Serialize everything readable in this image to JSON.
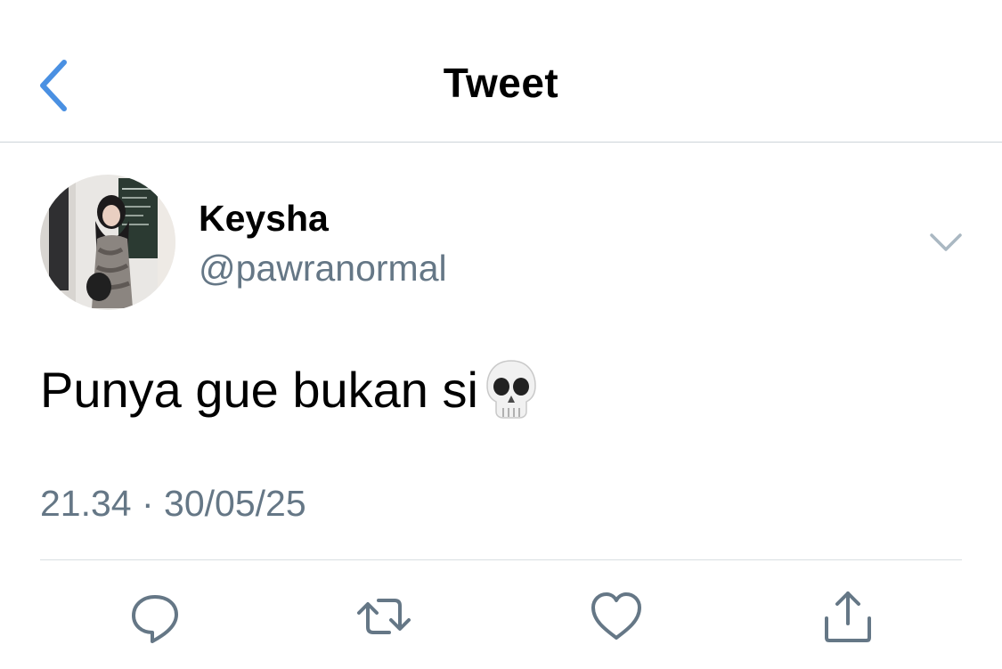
{
  "nav": {
    "title": "Tweet",
    "back_icon": "chevron-left-icon",
    "accent_color": "#4a90e2"
  },
  "tweet": {
    "author": {
      "display_name": "Keysha",
      "handle": "@pawranormal",
      "avatar": "profile-photo"
    },
    "text": "Punya gue bukan si",
    "emoji": "💀",
    "emoji_icon": "skull-emoji",
    "timestamp": "21.34 · 30/05/25",
    "menu_icon": "chevron-down-icon"
  },
  "actions": [
    {
      "name": "reply",
      "icon": "reply-icon"
    },
    {
      "name": "retweet",
      "icon": "retweet-icon"
    },
    {
      "name": "like",
      "icon": "heart-icon"
    },
    {
      "name": "share",
      "icon": "share-icon"
    }
  ],
  "colors": {
    "text_primary": "#000000",
    "text_secondary": "#657786",
    "icon_gray": "#657786",
    "divider": "#d9dee2"
  }
}
